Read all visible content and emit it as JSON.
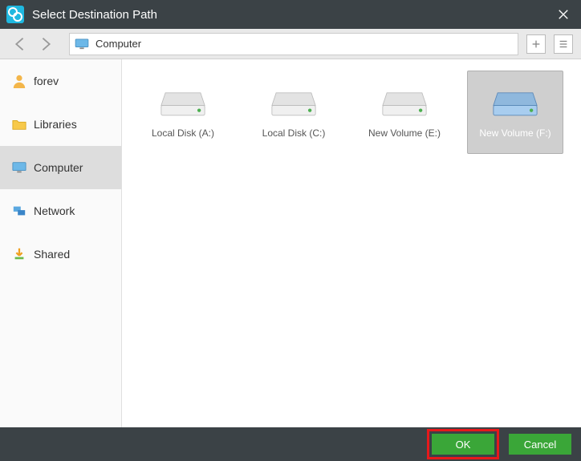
{
  "titlebar": {
    "title": "Select Destination Path"
  },
  "toolbar": {
    "breadcrumb": "Computer"
  },
  "sidebar": {
    "items": [
      {
        "label": "forev"
      },
      {
        "label": "Libraries"
      },
      {
        "label": "Computer"
      },
      {
        "label": "Network"
      },
      {
        "label": "Shared"
      }
    ]
  },
  "drives": [
    {
      "label": "Local Disk (A:)"
    },
    {
      "label": "Local Disk (C:)"
    },
    {
      "label": "New Volume (E:)"
    },
    {
      "label": "New Volume (F:)"
    }
  ],
  "footer": {
    "ok_label": "OK",
    "cancel_label": "Cancel"
  },
  "colors": {
    "accent": "#3aa638",
    "highlight": "#e7191b",
    "titlebar": "#3b4246"
  }
}
